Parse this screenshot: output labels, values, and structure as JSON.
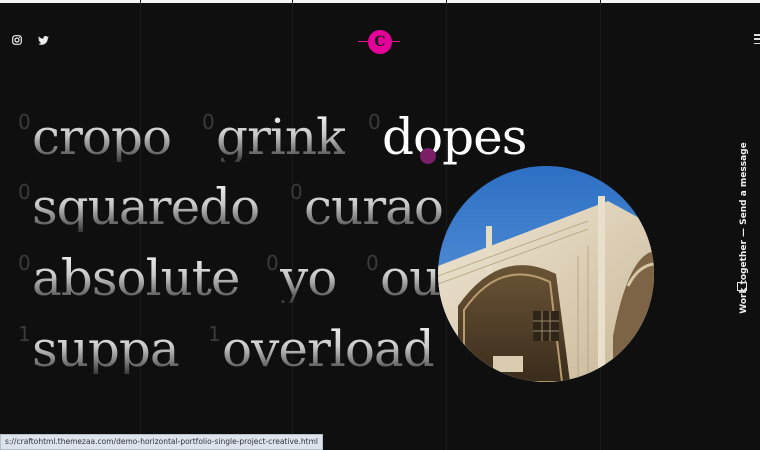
{
  "social": [
    {
      "name": "instagram-icon"
    },
    {
      "name": "twitter-icon"
    }
  ],
  "logo": {
    "letter": "C",
    "color": "#e5009a"
  },
  "menu": {
    "icon": "hamburger-menu-icon"
  },
  "projects": [
    {
      "num": "0",
      "title": "cropo",
      "active": false
    },
    {
      "num": "0",
      "title": "grink",
      "active": false
    },
    {
      "num": "0",
      "title": "dopes",
      "active": true
    },
    {
      "num": "0",
      "title": "squaredo",
      "active": false
    },
    {
      "num": "0",
      "title": "curao",
      "active": false
    },
    {
      "num": "0",
      "title": "absolute",
      "active": false
    },
    {
      "num": "0",
      "title": "yo",
      "active": false
    },
    {
      "num": "0",
      "title": "ou",
      "active": false
    },
    {
      "num": "1",
      "title": "suppa",
      "active": false
    },
    {
      "num": "1",
      "title": "overload",
      "active": false
    }
  ],
  "side": {
    "text": "Work together — Send a message",
    "icon": "mail-icon"
  },
  "status_url": "s://craftohtml.themezaa.com/demo-horizontal-portfolio-single-project-creative.html",
  "colors": {
    "background": "#0f0f10",
    "accent": "#e5009a"
  }
}
